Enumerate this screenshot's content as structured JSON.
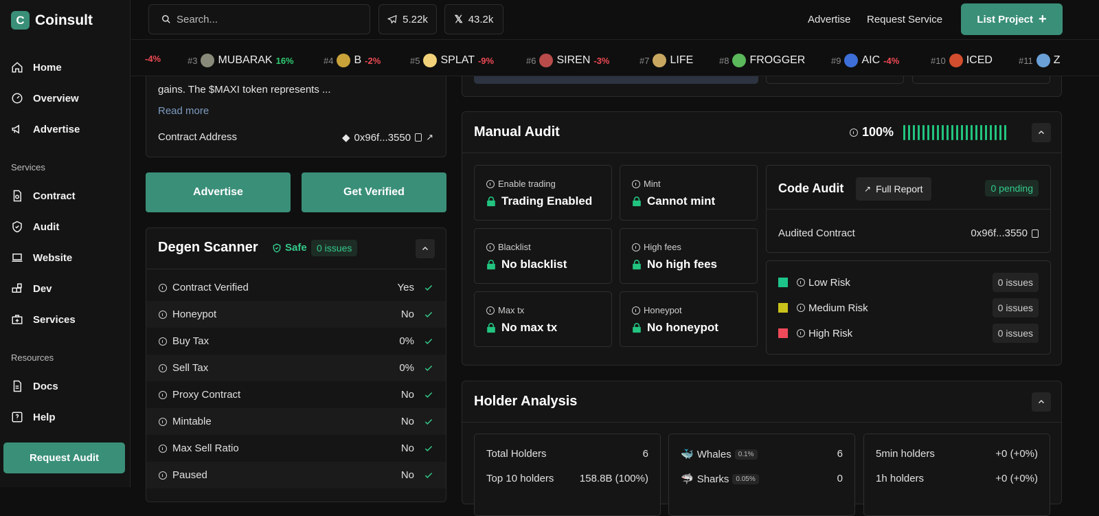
{
  "app": {
    "name": "Coinsult"
  },
  "sidebar": {
    "nav": [
      {
        "label": "Home",
        "icon": "home-icon"
      },
      {
        "label": "Overview",
        "icon": "gauge-icon"
      },
      {
        "label": "Advertise",
        "icon": "megaphone-icon"
      }
    ],
    "services_title": "Services",
    "services": [
      {
        "label": "Contract",
        "icon": "file-search-icon"
      },
      {
        "label": "Audit",
        "icon": "shield-icon"
      },
      {
        "label": "Website",
        "icon": "laptop-icon"
      },
      {
        "label": "Dev",
        "icon": "blocks-icon"
      },
      {
        "label": "Services",
        "icon": "briefcase-plus-icon"
      }
    ],
    "resources_title": "Resources",
    "resources": [
      {
        "label": "Docs",
        "icon": "doc-icon"
      },
      {
        "label": "Help",
        "icon": "help-icon"
      }
    ],
    "cta": "Request Audit"
  },
  "topbar": {
    "search_placeholder": "Search...",
    "telegram_count": "5.22k",
    "x_count": "43.2k",
    "advertise": "Advertise",
    "request_service": "Request Service",
    "list_project": "List Project"
  },
  "ticker": [
    {
      "rank": "",
      "name": "",
      "pct": "-4%",
      "dir": "neg",
      "color": ""
    },
    {
      "rank": "#3",
      "name": "MUBARAK",
      "pct": "16%",
      "dir": "pos",
      "color": "#8a8a7a"
    },
    {
      "rank": "#4",
      "name": "B",
      "pct": "-2%",
      "dir": "neg",
      "color": "#c9a23a"
    },
    {
      "rank": "#5",
      "name": "SPLAT",
      "pct": "-9%",
      "dir": "neg",
      "color": "#f1d27a"
    },
    {
      "rank": "#6",
      "name": "SIREN",
      "pct": "-3%",
      "dir": "neg",
      "color": "#b94b4b"
    },
    {
      "rank": "#7",
      "name": "LIFE",
      "pct": "",
      "dir": "pos",
      "color": "#c8a860"
    },
    {
      "rank": "#8",
      "name": "FROGGER",
      "pct": "",
      "dir": "pos",
      "color": "#5bb85b"
    },
    {
      "rank": "#9",
      "name": "AIC",
      "pct": "-4%",
      "dir": "neg",
      "color": "#3e6fd8"
    },
    {
      "rank": "#10",
      "name": "ICED",
      "pct": "",
      "dir": "pos",
      "color": "#d24e2e"
    },
    {
      "rank": "#11",
      "name": "Z",
      "pct": "",
      "dir": "pos",
      "color": "#6aa0d6"
    }
  ],
  "project": {
    "desc_line1": "...",
    "desc_line2": "gains. The $MAXI token represents ...",
    "read_more": "Read more",
    "contract_label": "Contract Address",
    "contract_value": "0x96f...3550"
  },
  "actions": {
    "advertise": "Advertise",
    "verify": "Get Verified"
  },
  "degen": {
    "title": "Degen Scanner",
    "safe": "Safe",
    "issues": "0 issues",
    "rows": [
      {
        "label": "Contract Verified",
        "value": "Yes"
      },
      {
        "label": "Honeypot",
        "value": "No"
      },
      {
        "label": "Buy Tax",
        "value": "0%"
      },
      {
        "label": "Sell Tax",
        "value": "0%"
      },
      {
        "label": "Proxy Contract",
        "value": "No"
      },
      {
        "label": "Mintable",
        "value": "No"
      },
      {
        "label": "Max Sell Ratio",
        "value": "No"
      },
      {
        "label": "Paused",
        "value": "No"
      }
    ]
  },
  "manual_audit": {
    "title": "Manual Audit",
    "score": "100%",
    "score_fraction": 1.0,
    "cards": [
      {
        "label": "Enable trading",
        "value": "Trading Enabled"
      },
      {
        "label": "Mint",
        "value": "Cannot mint"
      },
      {
        "label": "Blacklist",
        "value": "No blacklist"
      },
      {
        "label": "High fees",
        "value": "No high fees"
      },
      {
        "label": "Max tx",
        "value": "No max tx"
      },
      {
        "label": "Honeypot",
        "value": "No honeypot"
      }
    ],
    "code_audit": {
      "title": "Code Audit",
      "full_report": "Full Report",
      "pending": "0 pending",
      "audited_label": "Audited Contract",
      "audited_value": "0x96f...3550"
    },
    "risks": [
      {
        "label": "Low Risk",
        "count": "0 issues",
        "color": "#1ec58a"
      },
      {
        "label": "Medium Risk",
        "count": "0 issues",
        "color": "#c9c21a"
      },
      {
        "label": "High Risk",
        "count": "0 issues",
        "color": "#ef4a5a"
      }
    ]
  },
  "holders": {
    "title": "Holder Analysis",
    "total_label": "Total Holders",
    "total_value": "6",
    "top10_label": "Top 10 holders",
    "top10_value": "158.8B (100%)",
    "whales_label": "Whales",
    "whales_badge": "0.1%",
    "whales_value": "6",
    "sharks_label": "Sharks",
    "sharks_badge": "0.05%",
    "sharks_value": "0",
    "m5_label": "5min holders",
    "m5_value": "+0 (+0%)",
    "h1_label": "1h holders",
    "h1_value": "+0 (+0%)"
  },
  "colors": {
    "accent": "#3a8f78",
    "bg": "#0f0f0f",
    "panel": "#151515",
    "green": "#22c47f"
  }
}
